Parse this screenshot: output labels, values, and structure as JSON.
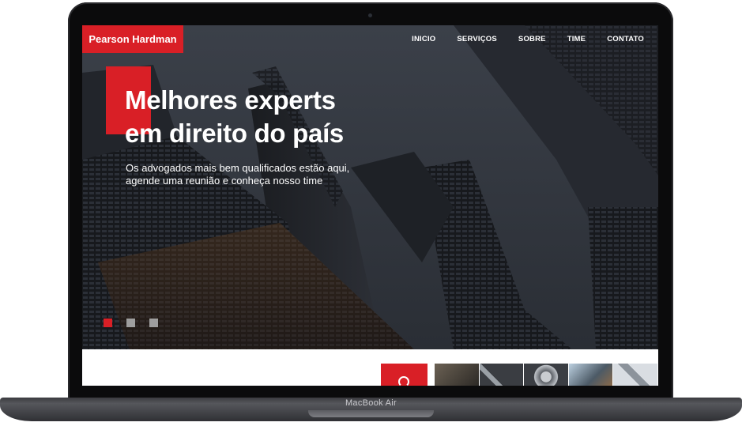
{
  "website": {
    "brand": "Pearson Hardman",
    "nav": [
      "INICIO",
      "SERVIÇOS",
      "SOBRE",
      "TIME",
      "CONTATO"
    ],
    "hero": {
      "headline_line1": "Melhores experts",
      "headline_line2": "em direito do país",
      "subtitle_line1": "Os advogados mais bem qualificados estão aqui,",
      "subtitle_line2": "agende uma reunião e conheça nosso time"
    },
    "slider": {
      "count": 3,
      "active_index": 0
    }
  },
  "device": {
    "label": "MacBook Air"
  },
  "colors": {
    "accent": "#d91f26",
    "dark": "#1b1d22",
    "inactive_dot": "#9e9e9e"
  },
  "icons": [
    "camera-dot-icon",
    "circle-icon"
  ]
}
